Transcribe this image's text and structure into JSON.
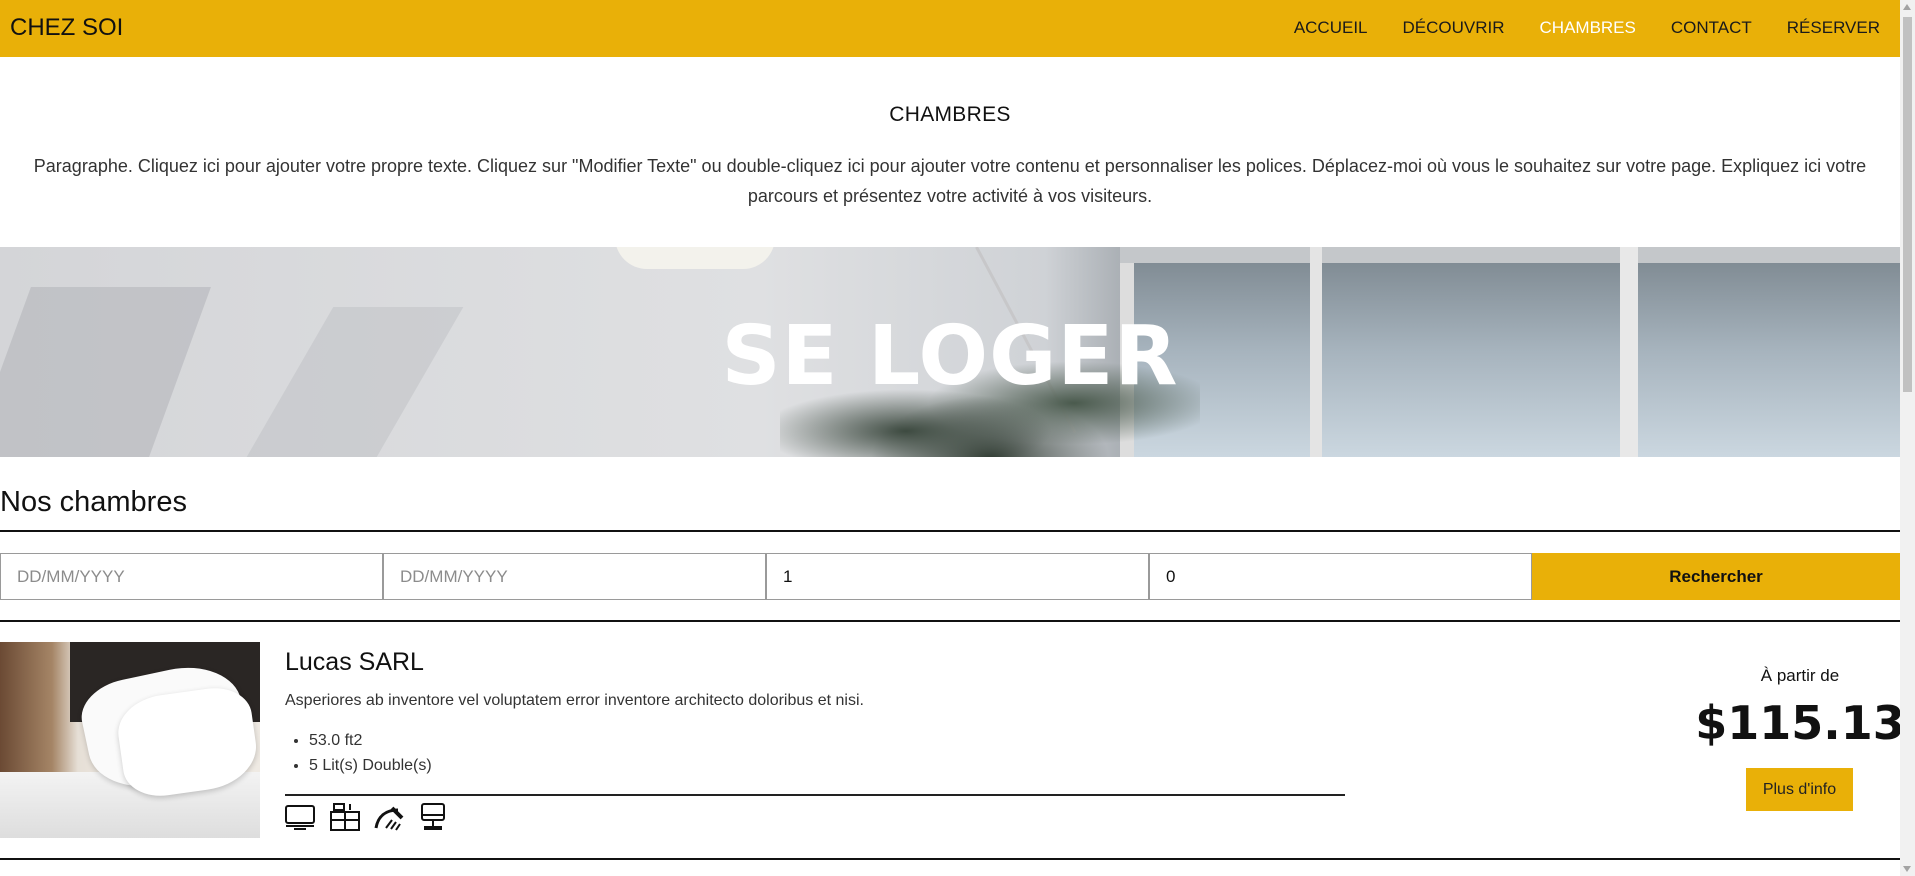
{
  "header": {
    "brand": "CHEZ SOI",
    "nav": [
      "ACCUEIL",
      "DÉCOUVRIR",
      "CHAMBRES",
      "CONTACT",
      "RÉSERVER"
    ],
    "active_nav": "CHAMBRES"
  },
  "intro": {
    "title": "CHAMBRES",
    "text": "Paragraphe. Cliquez ici pour ajouter votre propre texte. Cliquez sur \"Modifier Texte\" ou double-cliquez ici pour ajouter votre contenu et personnaliser les polices. Déplacez-moi où vous le souhaitez sur votre page. Expliquez ici votre parcours et présentez votre activité à vos visiteurs."
  },
  "hero": {
    "title": "SE LOGER"
  },
  "rooms_section": {
    "title": "Nos chambres",
    "search": {
      "checkin_placeholder": "DD/MM/YYYY",
      "checkout_placeholder": "DD/MM/YYYY",
      "adults_value": "1",
      "children_value": "0",
      "button_label": "Rechercher"
    },
    "rooms": [
      {
        "name": "Lucas SARL",
        "description": "Asperiores ab inventore vel voluptatem error inventore architecto doloribus et nisi.",
        "features": [
          "53.0 ft2",
          "5 Lit(s) Double(s)"
        ],
        "amenity_icons": [
          "tv-icon",
          "kitchen-icon",
          "shower-icon",
          "desktop-computer-icon"
        ],
        "price_label": "À partir de",
        "price": "$115.13",
        "button_label": "Plus d'info"
      }
    ]
  },
  "colors": {
    "accent": "#e9b008",
    "text": "#111111",
    "nav_active": "#ffffff"
  }
}
